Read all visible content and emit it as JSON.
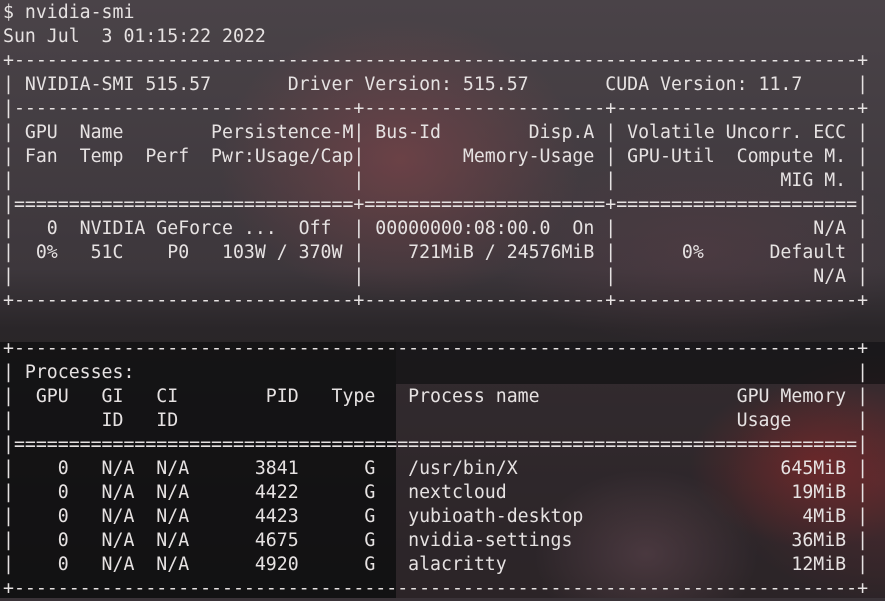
{
  "terminal": {
    "lines": [
      "$ nvidia-smi",
      "Sun Jul  3 01:15:22 2022",
      "+-----------------------------------------------------------------------------+",
      "| NVIDIA-SMI 515.57       Driver Version: 515.57       CUDA Version: 11.7     |",
      "|-------------------------------+----------------------+----------------------+",
      "| GPU  Name        Persistence-M| Bus-Id        Disp.A | Volatile Uncorr. ECC |",
      "| Fan  Temp  Perf  Pwr:Usage/Cap|         Memory-Usage | GPU-Util  Compute M. |",
      "|                               |                      |               MIG M. |",
      "|===============================+======================+======================|",
      "|   0  NVIDIA GeForce ...  Off  | 00000000:08:00.0  On |                  N/A |",
      "|  0%   51C    P0   103W / 370W |    721MiB / 24576MiB |      0%      Default |",
      "|                               |                      |                  N/A |",
      "+-------------------------------+----------------------+----------------------+",
      "",
      "+-----------------------------------------------------------------------------+",
      "| Processes:                                                                  |",
      "|  GPU   GI   CI        PID   Type   Process name                  GPU Memory |",
      "|        ID   ID                                                   Usage      |",
      "|=============================================================================|",
      "|    0   N/A  N/A      3841      G   /usr/bin/X                        645MiB |",
      "|    0   N/A  N/A      4422      G   nextcloud                          19MiB |",
      "|    0   N/A  N/A      4423      G   yubioath-desktop                    4MiB |",
      "|    0   N/A  N/A      4675      G   nvidia-settings                    36MiB |",
      "|    0   N/A  N/A      4920      G   alacritty                          12MiB |",
      "+-----------------------------------------------------------------------------+"
    ]
  }
}
